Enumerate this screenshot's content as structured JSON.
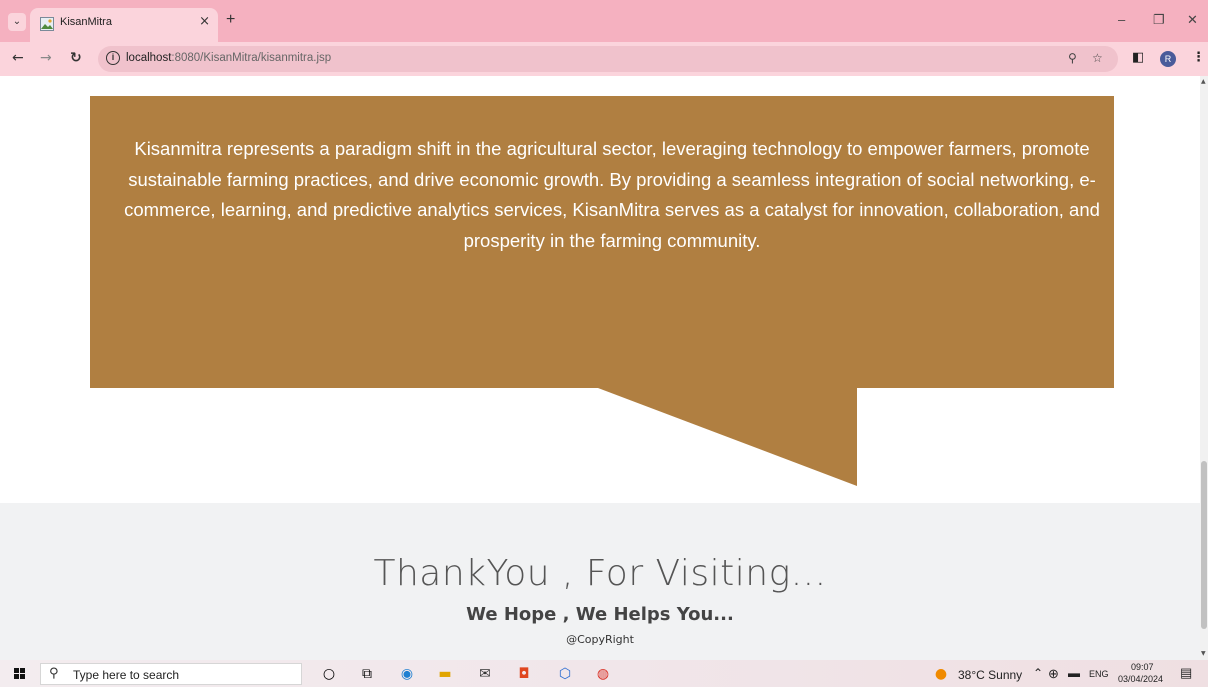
{
  "browser": {
    "tab_title": "KisanMitra",
    "tab_close": "×",
    "new_tab": "+",
    "url_host": "localhost",
    "url_rest": ":8080/KisanMitra/kisanmitra.jsp",
    "profile_initial": "R",
    "window_controls": {
      "minimize": "–",
      "restore": "❐",
      "close": "✕"
    }
  },
  "page": {
    "intro_text": "Kisanmitra represents a paradigm shift in the agricultural sector, leveraging technology to empower farmers, promote sustainable farming practices, and drive economic growth. By providing a seamless integration of social networking, e-commerce, learning, and predictive analytics services, KisanMitra serves as a catalyst for innovation, collaboration, and prosperity in the farming community.",
    "bubble_color": "#b07f41",
    "footer": {
      "thanks": "ThankYou , For Visiting...",
      "hope": "We Hope , We Helps You...",
      "copyright": "@CopyRight"
    }
  },
  "taskbar": {
    "search_placeholder": "Type here to search",
    "weather": "38°C  Sunny",
    "language": "ENG",
    "time": "09:07",
    "date": "03/04/2024"
  }
}
